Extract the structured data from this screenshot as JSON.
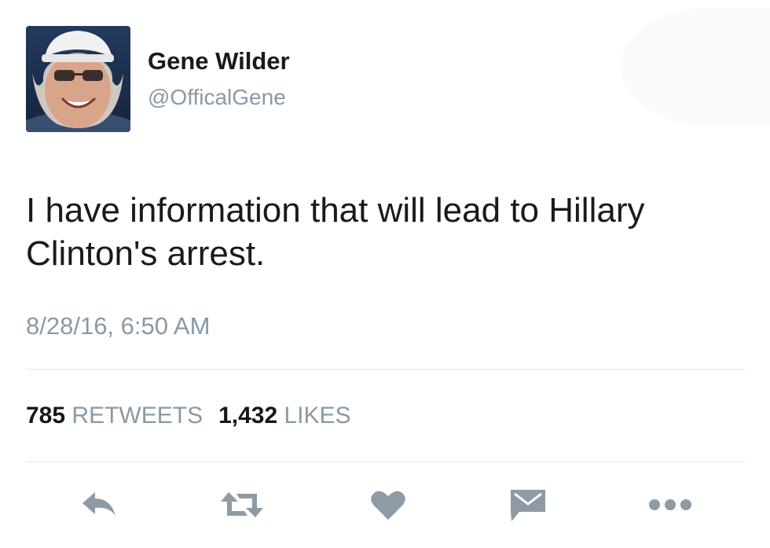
{
  "author": {
    "name": "Gene Wilder",
    "handle": "@OfficalGene"
  },
  "tweet": {
    "text": "I have information that will lead to Hillary Clinton's arrest.",
    "timestamp": "8/28/16, 6:50 AM"
  },
  "stats": {
    "retweets_count": "785",
    "retweets_label": "RETWEETS",
    "likes_count": "1,432",
    "likes_label": "LIKES"
  },
  "actions": {
    "icons": [
      "reply-icon",
      "retweet-icon",
      "like-icon",
      "direct-message-icon",
      "more-icon"
    ]
  },
  "colors": {
    "primary_text": "#1a1a1a",
    "secondary_text": "#8899a6",
    "icon_gray": "#8e9aa6",
    "divider": "#e1e8ed"
  }
}
